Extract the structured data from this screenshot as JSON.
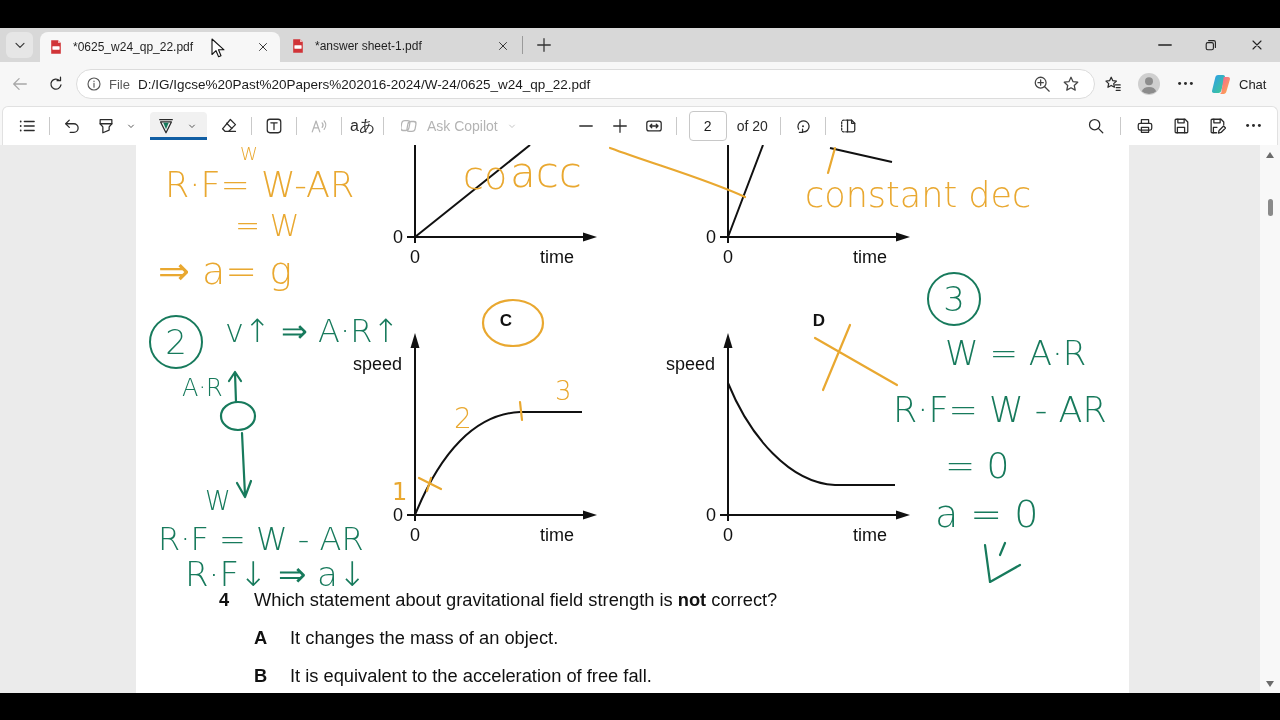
{
  "tabs": [
    {
      "title": "*0625_w24_qp_22.pdf",
      "selected": true
    },
    {
      "title": "*answer sheet-1.pdf",
      "selected": false
    }
  ],
  "address_bar": {
    "back_disabled": true,
    "scheme": "File",
    "url": "D:/IG/Igcse%20Past%20Papers%202016-2024/W-24/0625_w24_qp_22.pdf"
  },
  "chat_button": {
    "label": "Chat"
  },
  "pdf_toolbar": {
    "ink_tools": [
      {
        "kind": "highlight",
        "selected": false
      },
      {
        "kind": "draw",
        "selected": true
      },
      {
        "kind": "erase",
        "selected": false
      }
    ],
    "read_aloud": {
      "disabled": true
    },
    "translate": {
      "label": "aあ"
    },
    "ask_copilot": {
      "label": "Ask Copilot",
      "disabled": true
    },
    "page_number": "2",
    "page_total": "of 20"
  },
  "document": {
    "graph_rows": [
      [
        {
          "kind": "steady_rise",
          "y_origin": "0",
          "x_origin": "0",
          "x_label": "time"
        },
        {
          "kind": "steep_rise_then_fall",
          "y_origin": "0",
          "x_origin": "0",
          "x_label": "time"
        }
      ],
      [
        {
          "label": "C",
          "kind": "rise_to_plateau",
          "y_label": "speed",
          "y_origin": "0",
          "x_origin": "0",
          "x_label": "time"
        },
        {
          "label": "D",
          "kind": "fall_to_plateau",
          "y_label": "speed",
          "y_origin": "0",
          "x_origin": "0",
          "x_label": "time"
        }
      ]
    ],
    "question": {
      "number": "4",
      "text": "Which statement about gravitational field strength is **not** correct?",
      "options": [
        {
          "letter": "A",
          "text": "It changes the mass of an object."
        },
        {
          "letter": "B",
          "text": "It is equivalent to the acceleration of free fall."
        }
      ]
    }
  },
  "annotations": [
    {
      "kind": "text",
      "text": "W",
      "color": "#e9a830"
    },
    {
      "kind": "text",
      "text": "R·F= W-AR",
      "color": "#e9a830"
    },
    {
      "kind": "text",
      "text": "= W",
      "color": "#e9a830"
    },
    {
      "kind": "text",
      "text": "⇒ a= g",
      "color": "#e9a830"
    },
    {
      "kind": "text",
      "text": "co",
      "color": "#e9a830"
    },
    {
      "kind": "text",
      "text": "acc",
      "color": "#e9a830"
    },
    {
      "kind": "text",
      "text": "constant dec",
      "color": "#e9a830"
    },
    {
      "kind": "text",
      "text": "1",
      "color": "#e9a830"
    },
    {
      "kind": "text",
      "text": "2",
      "color": "#e9a830"
    },
    {
      "kind": "text",
      "text": "3",
      "color": "#e9a830"
    },
    {
      "kind": "circled",
      "text": "2",
      "color": "#177a5c"
    },
    {
      "kind": "text",
      "text": "v↑ ⇒ A·R↑",
      "color": "#177a5c"
    },
    {
      "kind": "text",
      "text": "A·R",
      "color": "#177a5c"
    },
    {
      "kind": "text",
      "text": "W",
      "color": "#177a5c"
    },
    {
      "kind": "text",
      "text": "R·F = W - AR",
      "color": "#177a5c"
    },
    {
      "kind": "text",
      "text": "R·F↓ ⇒ a↓",
      "color": "#177a5c"
    },
    {
      "kind": "circled",
      "text": "3",
      "color": "#177a5c"
    },
    {
      "kind": "text",
      "text": "W = A·R",
      "color": "#177a5c"
    },
    {
      "kind": "text",
      "text": "R·F= W - AR",
      "color": "#177a5c"
    },
    {
      "kind": "text",
      "text": "= 0",
      "color": "#177a5c"
    },
    {
      "kind": "text",
      "text": "a = 0",
      "color": "#177a5c"
    }
  ]
}
